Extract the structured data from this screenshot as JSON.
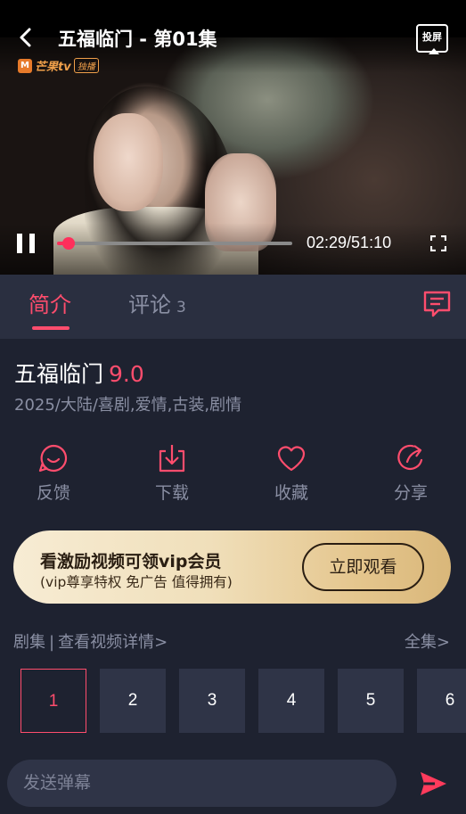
{
  "player": {
    "title": "五福临门 - 第01集",
    "cast_label": "投屏",
    "watermark": {
      "logo": "M",
      "brand": "芒果tv",
      "badge": "独播"
    },
    "progress": {
      "fraction": 0.048
    },
    "time": "02:29/51:10",
    "icons": {
      "back": "chevron-left-icon",
      "cast": "cast-screen-icon",
      "pause": "pause-icon",
      "fullscreen": "fullscreen-icon"
    }
  },
  "tabs": {
    "intro": "简介",
    "comments": "评论",
    "comments_count": "3",
    "danmaku_icon": "danmaku-list-icon"
  },
  "show": {
    "title": "五福临门",
    "score": "9.0",
    "meta": "2025/大陆/喜剧,爱情,古装,剧情"
  },
  "actions": [
    {
      "label": "反馈",
      "icon": "feedback-icon"
    },
    {
      "label": "下载",
      "icon": "download-icon"
    },
    {
      "label": "收藏",
      "icon": "heart-icon"
    },
    {
      "label": "分享",
      "icon": "share-icon"
    }
  ],
  "vip": {
    "title": "看激励视频可领vip会员",
    "subtitle": "(vip尊享特权 免广告 值得拥有)",
    "button": "立即观看"
  },
  "episodes": {
    "header_label": "剧集",
    "separator": "|",
    "details_link": "查看视频详情>",
    "all_link": "全集>",
    "items": [
      "1",
      "2",
      "3",
      "4",
      "5",
      "6"
    ],
    "selected": "1"
  },
  "danmaku": {
    "placeholder": "发送弹幕",
    "send_icon": "send-icon"
  },
  "colors": {
    "accent": "#ff4d6d",
    "background": "#1e2230",
    "muted_text": "#8a8fa3",
    "vip_gold": "#e4c58c"
  }
}
